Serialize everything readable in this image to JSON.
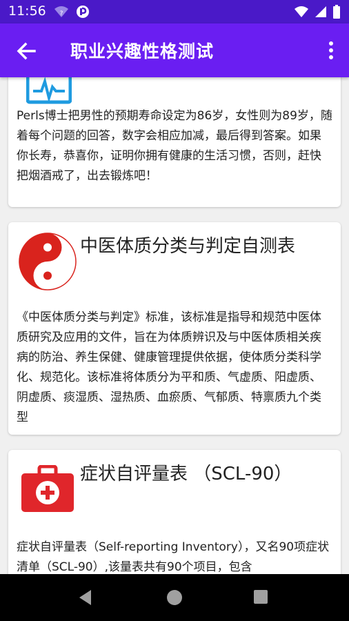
{
  "status_bar": {
    "time": "11:56",
    "icons": [
      "wifi-question-icon",
      "app-notification-icon",
      "wifi-icon",
      "signal-icon",
      "battery-icon"
    ]
  },
  "app_bar": {
    "title": "职业兴趣性格测试",
    "back_icon": "arrow-left-icon",
    "menu_icon": "more-vertical-icon"
  },
  "cards": [
    {
      "icon": "heart-monitor-icon",
      "title": "",
      "description": "Perls博士把男性的预期寿命设定为86岁，女性则为89岁，随着每个问题的回答，数字会相应加减，最后得到答案。如果你长寿，恭喜你，证明你拥有健康的生活习惯，否则，赶快把烟酒戒了，出去锻炼吧！"
    },
    {
      "icon": "yin-yang-icon",
      "title": "中医体质分类与判定自测表",
      "description": "《中医体质分类与判定》标准，该标准是指导和规范中医体质研究及应用的文件，旨在为体质辨识及与中医体质相关疾病的防治、养生保健、健康管理提供依据，使体质分类科学化、规范化。该标准将体质分为平和质、气虚质、阳虚质、阴虚质、痰湿质、湿热质、血瘀质、气郁质、特禀质九个类型"
    },
    {
      "icon": "first-aid-kit-icon",
      "title": "症状自评量表 （SCL-90）",
      "description": "症状自评量表（Self-reporting Inventory），又名90项症状清单（SCL-90）,该量表共有90个项目，包含"
    }
  ],
  "colors": {
    "status_bar": "#4a19c8",
    "app_bar": "#6a1ef2",
    "yin_yang_red": "#d9231d",
    "first_aid_red": "#e0262b",
    "monitor_blue": "#1f9be0"
  },
  "nav_bar": {
    "icons": [
      "nav-back-icon",
      "nav-home-icon",
      "nav-recents-icon"
    ]
  }
}
